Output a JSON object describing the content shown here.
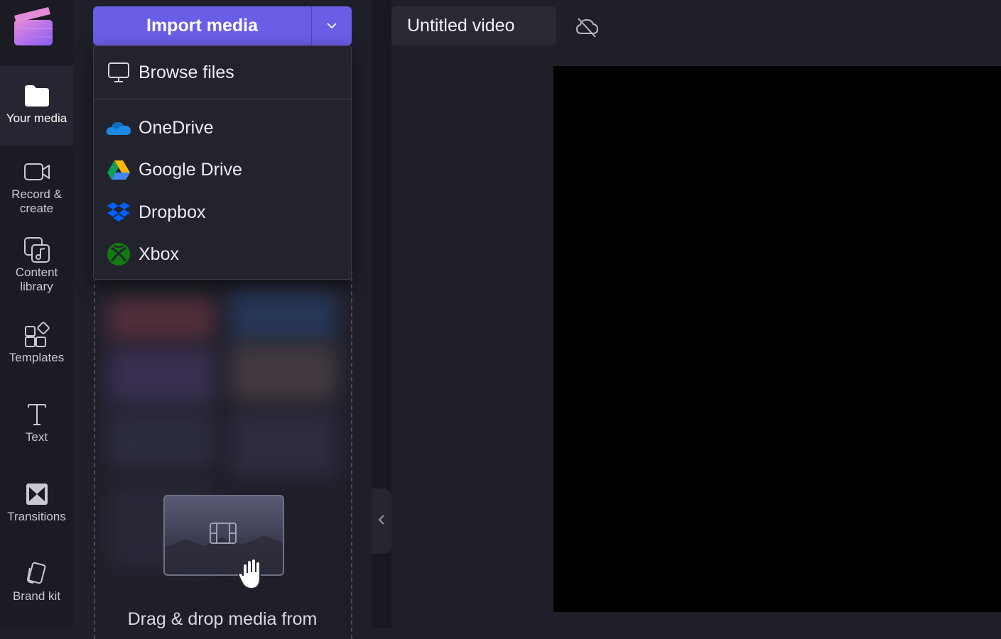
{
  "nav": {
    "items": [
      {
        "label": "Your media",
        "icon": "folder-icon"
      },
      {
        "label": "Record & create",
        "icon": "video-camera-icon"
      },
      {
        "label": "Content library",
        "icon": "content-library-icon"
      },
      {
        "label": "Templates",
        "icon": "templates-icon"
      },
      {
        "label": "Text",
        "icon": "text-icon"
      },
      {
        "label": "Transitions",
        "icon": "transitions-icon"
      },
      {
        "label": "Brand kit",
        "icon": "brand-kit-icon"
      }
    ]
  },
  "import": {
    "label": "Import media"
  },
  "menu": {
    "items": [
      {
        "label": "Browse files",
        "icon": "monitor-icon"
      },
      {
        "label": "OneDrive",
        "icon": "onedrive-icon"
      },
      {
        "label": "Google Drive",
        "icon": "google-drive-icon"
      },
      {
        "label": "Dropbox",
        "icon": "dropbox-icon"
      },
      {
        "label": "Xbox",
        "icon": "xbox-icon"
      }
    ]
  },
  "dropzone": {
    "text": "Drag & drop media from"
  },
  "project": {
    "title": "Untitled video"
  },
  "colors": {
    "accent": "#6a5de6",
    "background": "#1f1f29",
    "preview": "#000000"
  }
}
